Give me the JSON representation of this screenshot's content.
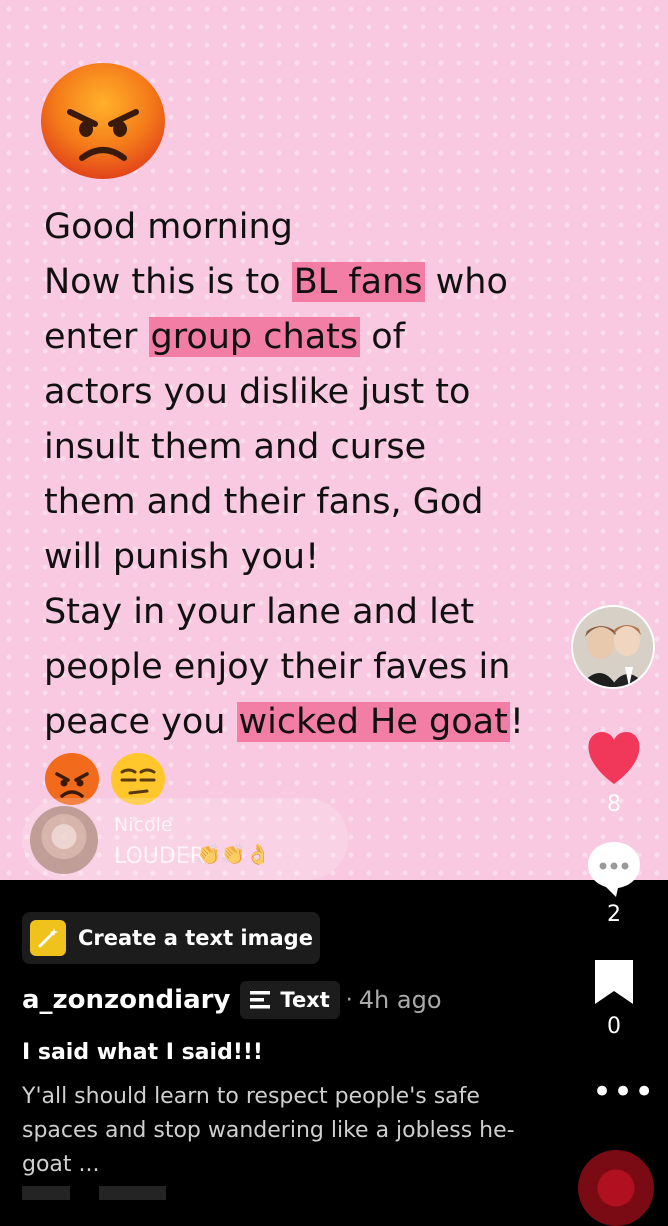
{
  "post": {
    "emoji_big": "angry-face",
    "lines": [
      [
        {
          "t": "Good morning"
        }
      ],
      [
        {
          "t": "Now this is to "
        },
        {
          "t": "BL fans",
          "hl": true
        },
        {
          "t": " who"
        }
      ],
      [
        {
          "t": "enter "
        },
        {
          "t": "group chats",
          "hl": true
        },
        {
          "t": " of"
        }
      ],
      [
        {
          "t": "actors you dislike just to"
        }
      ],
      [
        {
          "t": "insult them and curse"
        }
      ],
      [
        {
          "t": "them and their fans, God"
        }
      ],
      [
        {
          "t": "will punish you!"
        }
      ],
      [
        {
          "t": "Stay in your lane and let"
        }
      ],
      [
        {
          "t": "people enjoy their faves in"
        }
      ],
      [
        {
          "t": "peace you "
        },
        {
          "t": "wicked He goat",
          "hl": true
        },
        {
          "t": "!"
        }
      ]
    ],
    "emoji_row": [
      "angry-face",
      "unamused-face"
    ],
    "highlight_color": "#f27ea5",
    "background_color": "#f8c9e1"
  },
  "overlay_comment": {
    "name": "Nicole",
    "message": "LOUDER",
    "claps": "👏👏👌"
  },
  "rail": {
    "likes": "8",
    "comments": "2",
    "saves": "0",
    "more": "•••"
  },
  "create_chip": {
    "label": "Create a text image"
  },
  "meta": {
    "username": "a_zonzondiary",
    "type_label": "Text",
    "separator": "·",
    "time": "4h ago"
  },
  "caption": {
    "title": "I said what I said!!!",
    "body": "Y'all should learn to respect people's safe spaces and stop wandering like a jobless he-goat ..."
  }
}
